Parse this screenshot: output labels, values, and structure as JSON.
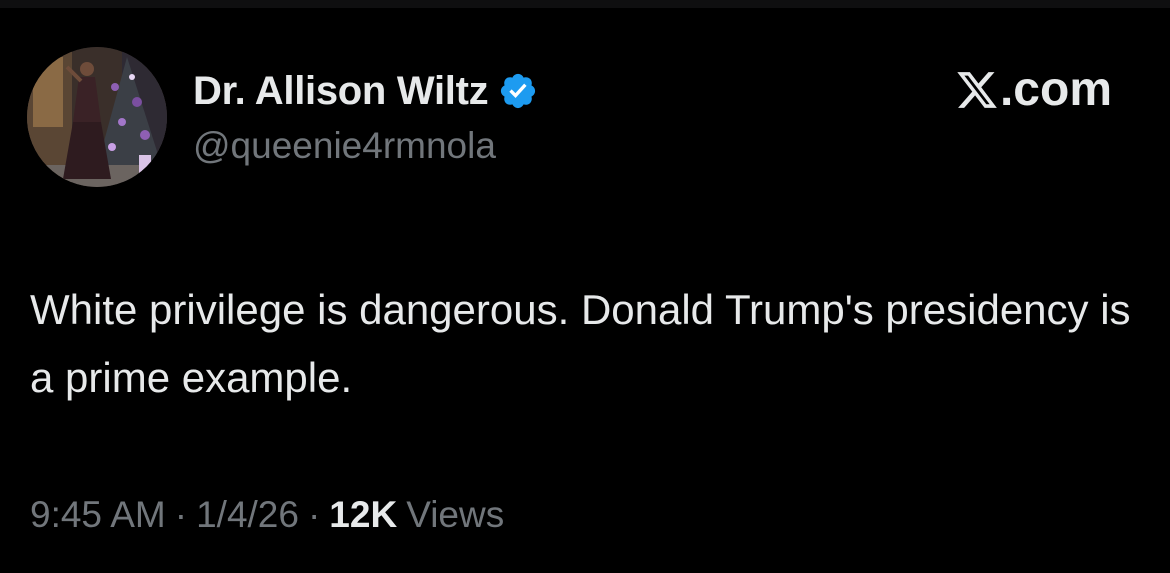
{
  "brand": {
    "label": ".com",
    "icon": "x-logo-icon"
  },
  "author": {
    "display_name": "Dr. Allison Wiltz",
    "handle": "@queenie4rmnola",
    "verified_icon": "verified-badge-icon",
    "verified_color": "#1d9bf0"
  },
  "post": {
    "text": "White privilege is dangerous. Donald Trump's presidency is a prime example."
  },
  "meta": {
    "time": "9:45 AM",
    "date": "1/4/26",
    "separator": "·",
    "views_count": "12K",
    "views_label": "Views"
  },
  "colors": {
    "background": "#000000",
    "primary_text": "#e7e9ea",
    "secondary_text": "#71767b"
  }
}
